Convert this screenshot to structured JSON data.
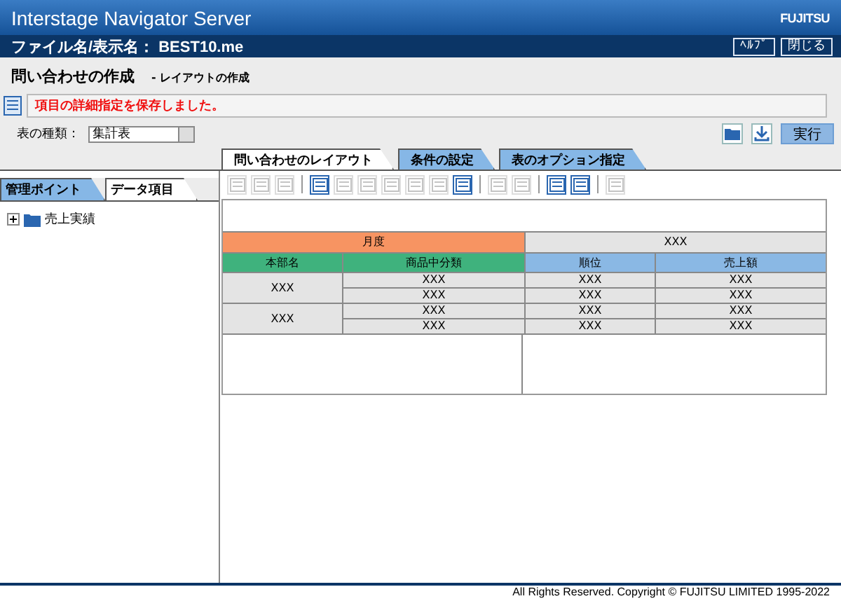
{
  "window": {
    "title": "Interstage Navigator Server",
    "logo": "FUJITSU"
  },
  "file_bar": {
    "label": "ファイル名/表示名：",
    "file": "BEST10.me",
    "buttons": [
      "ﾍﾙﾌﾟ",
      "閉じる"
    ]
  },
  "page": {
    "title": "問い合わせの作成",
    "subtitle": "- レイアウトの作成"
  },
  "message": "項目の詳細指定を保存しました。",
  "table_type": {
    "label": "表の種類：",
    "value": "集計表"
  },
  "run_button": "実行",
  "tabs": [
    {
      "label": "問い合わせのレイアウト",
      "selected": true
    },
    {
      "label": "条件の設定",
      "selected": false
    },
    {
      "label": "表のオプション指定",
      "selected": false
    }
  ],
  "left_tabs": [
    {
      "label": "管理ポイント",
      "selected": false
    },
    {
      "label": "データ項目",
      "selected": true
    }
  ],
  "tree": [
    {
      "label": "売上実績",
      "expanded": false
    }
  ],
  "toolbar": [
    [
      {
        "disabled": true
      },
      {
        "disabled": true
      },
      {
        "disabled": true
      }
    ],
    [
      {
        "disabled": false
      },
      {
        "disabled": true
      },
      {
        "disabled": true
      },
      {
        "disabled": true
      },
      {
        "disabled": true
      },
      {
        "disabled": true
      },
      {
        "disabled": false
      }
    ],
    [
      {
        "disabled": true
      },
      {
        "disabled": true
      }
    ],
    [
      {
        "disabled": false
      },
      {
        "disabled": false
      }
    ],
    [
      {
        "disabled": true
      }
    ]
  ],
  "layout": {
    "column_field": "月度",
    "column_value": "XXX",
    "columns": [
      {
        "label": "本部名",
        "kind": "row"
      },
      {
        "label": "商品中分類",
        "kind": "row"
      },
      {
        "label": "順位",
        "kind": "data"
      },
      {
        "label": "売上額",
        "kind": "data"
      }
    ],
    "groups": [
      {
        "label": "XXX",
        "rows": [
          [
            "XXX",
            "XXX",
            "XXX"
          ],
          [
            "XXX",
            "XXX",
            "XXX"
          ]
        ]
      },
      {
        "label": "XXX",
        "rows": [
          [
            "XXX",
            "XXX",
            "XXX"
          ],
          [
            "XXX",
            "XXX",
            "XXX"
          ]
        ]
      }
    ]
  },
  "footer": "All Rights Reserved. Copyright © FUJITSU LIMITED 1995-2022"
}
